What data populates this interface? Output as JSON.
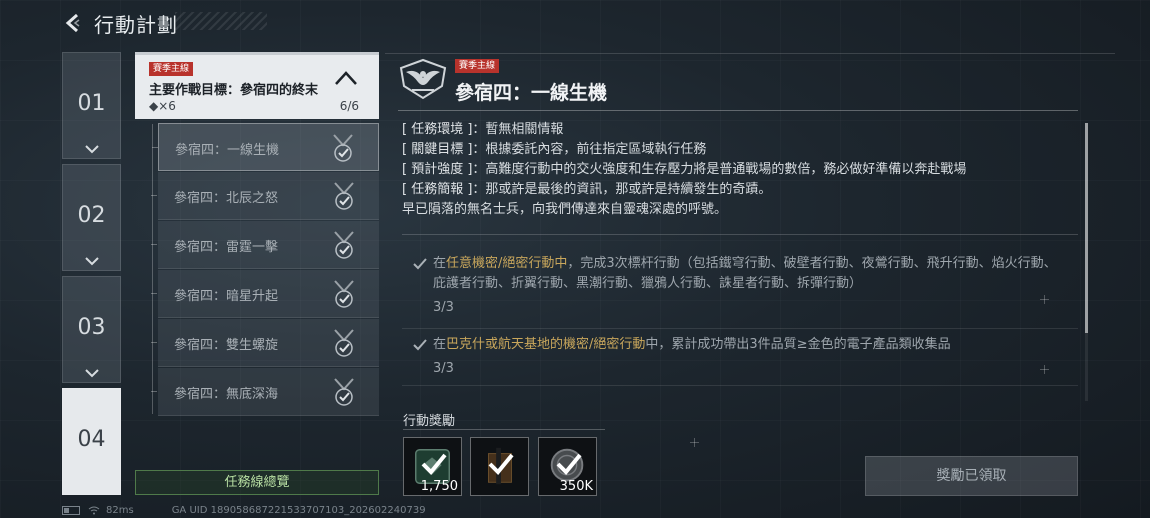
{
  "header": {
    "title": "行動計劃"
  },
  "chapters": [
    "01",
    "02",
    "03",
    "04"
  ],
  "chain": {
    "badge": "賽季主線",
    "title": "主要作戰目標：參宿四的終末",
    "reward": "◆×6",
    "progress": "6/6"
  },
  "missions": [
    {
      "label": "參宿四：一線生機"
    },
    {
      "label": "參宿四：北辰之怒"
    },
    {
      "label": "參宿四：雷霆一擊"
    },
    {
      "label": "參宿四：暗星升起"
    },
    {
      "label": "參宿四：雙生螺旋"
    },
    {
      "label": "參宿四：無底深海"
    }
  ],
  "overview_button": "任務線總覽",
  "detail": {
    "badge": "賽季主線",
    "title": "參宿四：一線生機",
    "brief": [
      {
        "key": "[ 任務環境 ]",
        "value": "：暫無相關情報"
      },
      {
        "key": "[ 關鍵目標 ]",
        "value": "：根據委託內容，前往指定區域執行任務"
      },
      {
        "key": "[ 預計強度 ]",
        "value": "：高難度行動中的交火強度和生存壓力將是普通戰場的數倍，務必做好準備以奔赴戰場"
      },
      {
        "key": "[ 任務簡報 ]",
        "value": "：那或許是最後的資訊，那或許是持續發生的奇蹟。"
      }
    ],
    "brief_line5": "早已隕落的無名士兵，向我們傳達來自靈魂深處的呼號。"
  },
  "objectives": [
    {
      "pre": "在",
      "highlight": "任意機密/絕密行動中",
      "post": "，完成3次標杆行動（包括鐵穹行動、破壁者行動、夜鶯行動、飛升行動、焰火行動、庇護者行動、折翼行動、黑潮行動、獵鴉人行動、誅星者行動、拆彈行動）",
      "progress": "3/3"
    },
    {
      "pre": "在",
      "highlight": "巴克什或航天基地的機密/絕密行動",
      "post": "中，累計成功帶出3件品質≥金色的電子產品類收集品",
      "progress": "3/3"
    }
  ],
  "rewards": {
    "label": "行動獎勵",
    "items": [
      {
        "amount": "1,750",
        "icon": "emblem-icon",
        "color": "#2f5e4c"
      },
      {
        "amount": "",
        "icon": "rifle-crate-icon",
        "color": "#6b4a2a"
      },
      {
        "amount": "350K",
        "icon": "coin-icon",
        "color": "#6d7378"
      }
    ]
  },
  "claimed_button": "獎勵已領取",
  "footer": {
    "ping": "82ms",
    "uid": "GA UID 189058687221533707103_202602240739"
  },
  "colors": {
    "accent_green": "#b8dfa3",
    "highlight_gold": "#c9a75c",
    "badge_red": "#b8332c"
  }
}
